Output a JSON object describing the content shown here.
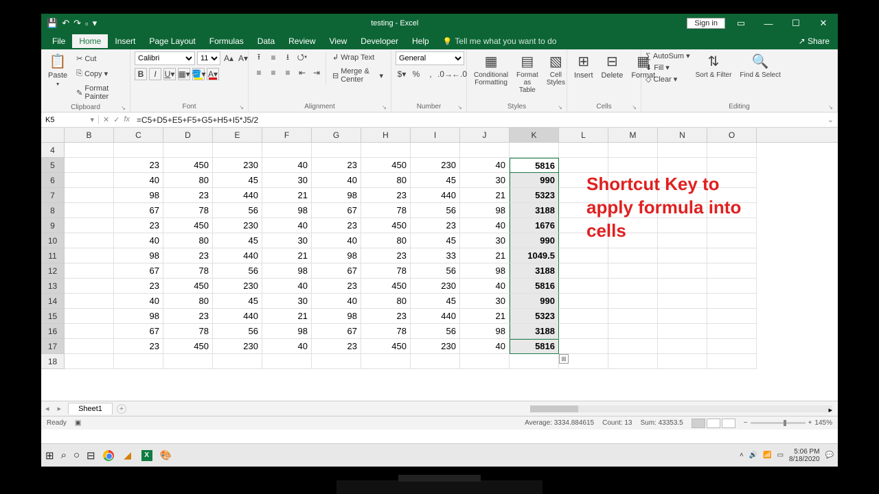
{
  "title": "testing  -  Excel",
  "signin": "Sign in",
  "menu": {
    "file": "File",
    "home": "Home",
    "insert": "Insert",
    "pagelayout": "Page Layout",
    "formulas": "Formulas",
    "data": "Data",
    "review": "Review",
    "view": "View",
    "developer": "Developer",
    "help": "Help",
    "tell": "Tell me what you want to do",
    "share": "Share"
  },
  "ribbon": {
    "clipboard": {
      "paste": "Paste",
      "cut": "Cut",
      "copy": "Copy",
      "fmt": "Format Painter",
      "label": "Clipboard"
    },
    "font": {
      "name": "Calibri",
      "size": "11",
      "label": "Font"
    },
    "align": {
      "wrap": "Wrap Text",
      "merge": "Merge & Center",
      "label": "Alignment"
    },
    "number": {
      "fmt": "General",
      "label": "Number"
    },
    "styles": {
      "cond": "Conditional Formatting",
      "table": "Format as Table",
      "cell": "Cell Styles",
      "label": "Styles"
    },
    "cells": {
      "insert": "Insert",
      "delete": "Delete",
      "format": "Format",
      "label": "Cells"
    },
    "editing": {
      "sum": "AutoSum",
      "fill": "Fill",
      "clear": "Clear",
      "sort": "Sort & Filter",
      "find": "Find & Select",
      "label": "Editing"
    }
  },
  "namebox": "K5",
  "formula": "=C5+D5+E5+F5+G5+H5+I5*J5/2",
  "cols": [
    "B",
    "C",
    "D",
    "E",
    "F",
    "G",
    "H",
    "I",
    "J",
    "K",
    "L",
    "M",
    "N",
    "O"
  ],
  "rowHeaders": [
    "4",
    "5",
    "6",
    "7",
    "8",
    "9",
    "10",
    "11",
    "12",
    "13",
    "14",
    "15",
    "16",
    "17",
    "18"
  ],
  "rows": [
    [
      "",
      "",
      "",
      "",
      "",
      "",
      "",
      "",
      "",
      "",
      "",
      "",
      "",
      ""
    ],
    [
      "",
      "23",
      "450",
      "230",
      "40",
      "23",
      "450",
      "230",
      "40",
      "5816",
      "",
      "",
      "",
      ""
    ],
    [
      "",
      "40",
      "80",
      "45",
      "30",
      "40",
      "80",
      "45",
      "30",
      "990",
      "",
      "",
      "",
      ""
    ],
    [
      "",
      "98",
      "23",
      "440",
      "21",
      "98",
      "23",
      "440",
      "21",
      "5323",
      "",
      "",
      "",
      ""
    ],
    [
      "",
      "67",
      "78",
      "56",
      "98",
      "67",
      "78",
      "56",
      "98",
      "3188",
      "",
      "",
      "",
      ""
    ],
    [
      "",
      "23",
      "450",
      "230",
      "40",
      "23",
      "450",
      "23",
      "40",
      "1676",
      "",
      "",
      "",
      ""
    ],
    [
      "",
      "40",
      "80",
      "45",
      "30",
      "40",
      "80",
      "45",
      "30",
      "990",
      "",
      "",
      "",
      ""
    ],
    [
      "",
      "98",
      "23",
      "440",
      "21",
      "98",
      "23",
      "33",
      "21",
      "1049.5",
      "",
      "",
      "",
      ""
    ],
    [
      "",
      "67",
      "78",
      "56",
      "98",
      "67",
      "78",
      "56",
      "98",
      "3188",
      "",
      "",
      "",
      ""
    ],
    [
      "",
      "23",
      "450",
      "230",
      "40",
      "23",
      "450",
      "230",
      "40",
      "5816",
      "",
      "",
      "",
      ""
    ],
    [
      "",
      "40",
      "80",
      "45",
      "30",
      "40",
      "80",
      "45",
      "30",
      "990",
      "",
      "",
      "",
      ""
    ],
    [
      "",
      "98",
      "23",
      "440",
      "21",
      "98",
      "23",
      "440",
      "21",
      "5323",
      "",
      "",
      "",
      ""
    ],
    [
      "",
      "67",
      "78",
      "56",
      "98",
      "67",
      "78",
      "56",
      "98",
      "3188",
      "",
      "",
      "",
      ""
    ],
    [
      "",
      "23",
      "450",
      "230",
      "40",
      "23",
      "450",
      "230",
      "40",
      "5816",
      "",
      "",
      "",
      ""
    ],
    [
      "",
      "",
      "",
      "",
      "",
      "",
      "",
      "",
      "",
      "",
      "",
      "",
      "",
      ""
    ]
  ],
  "overlay": "Shortcut Key to apply formula into cells",
  "sheet": "Sheet1",
  "status": {
    "ready": "Ready",
    "avg": "Average: 3334.884615",
    "count": "Count: 13",
    "sum": "Sum: 43353.5",
    "zoom": "145%"
  },
  "taskbar": {
    "time": "5:06 PM",
    "date": "8/18/2020"
  }
}
